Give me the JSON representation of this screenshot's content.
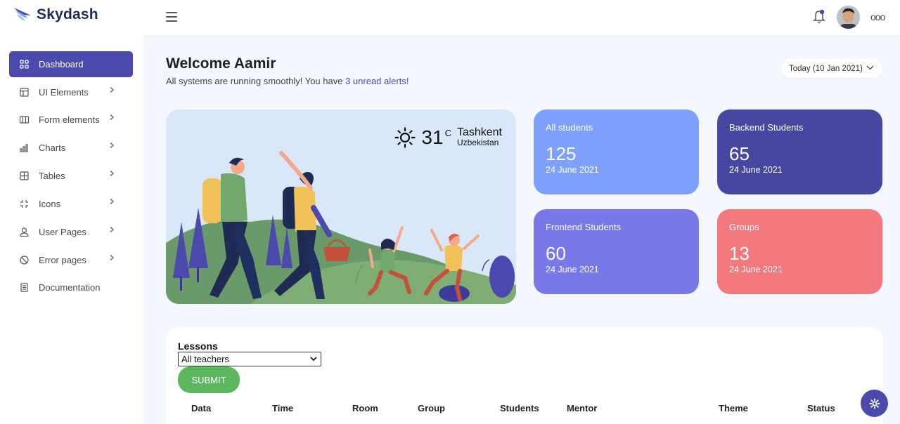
{
  "brand": {
    "name": "Skydash"
  },
  "header": {
    "menu_icon": "hamburger-icon",
    "notification_icon": "bell-icon",
    "more_icon": "more-horizontal-icon",
    "more_label": "ooo"
  },
  "sidebar": {
    "items": [
      {
        "label": "Dashboard",
        "icon": "grid-icon",
        "active": true,
        "has_chevron": false
      },
      {
        "label": "UI Elements",
        "icon": "layout-icon",
        "has_chevron": true
      },
      {
        "label": "Form elements",
        "icon": "columns-icon",
        "has_chevron": true
      },
      {
        "label": "Charts",
        "icon": "bar-chart-icon",
        "has_chevron": true
      },
      {
        "label": "Tables",
        "icon": "table-icon",
        "has_chevron": true
      },
      {
        "label": "Icons",
        "icon": "compass-icon",
        "has_chevron": true
      },
      {
        "label": "User Pages",
        "icon": "user-icon",
        "has_chevron": true
      },
      {
        "label": "Error pages",
        "icon": "ban-icon",
        "has_chevron": true
      },
      {
        "label": "Documentation",
        "icon": "document-icon",
        "has_chevron": false
      }
    ]
  },
  "main": {
    "welcome": "Welcome Aamir",
    "subline_prefix": "All systems are running smoothly! You have ",
    "subline_link": "3 unread alerts!",
    "date_button": "Today (10 Jan 2021)"
  },
  "weather": {
    "icon": "sun-icon",
    "temperature": "31",
    "unit": "C",
    "city": "Tashkent",
    "country": "Uzbekistan"
  },
  "stats": [
    {
      "label": "All students",
      "value": "125",
      "date": "24 June 2021",
      "color": "#7da0fa"
    },
    {
      "label": "Backend Students",
      "value": "65",
      "date": "24 June 2021",
      "color": "#4747a1"
    },
    {
      "label": "Frontend Students",
      "value": "60",
      "date": "24 June 2021",
      "color": "#7978e9"
    },
    {
      "label": "Groups",
      "value": "13",
      "date": "24 June 2021",
      "color": "#f3797e"
    }
  ],
  "lessons": {
    "title": "Lessons",
    "select_value": "All teachers",
    "submit_label": "SUBMIT",
    "columns": [
      "Data",
      "Time",
      "Room",
      "Group",
      "Students",
      "Mentor",
      "Theme",
      "Status"
    ]
  },
  "fab": {
    "icon": "gear-icon"
  },
  "colors": {
    "accent": "#4b49ac",
    "success": "#5cb85c",
    "page_bg": "#f5f7ff"
  }
}
